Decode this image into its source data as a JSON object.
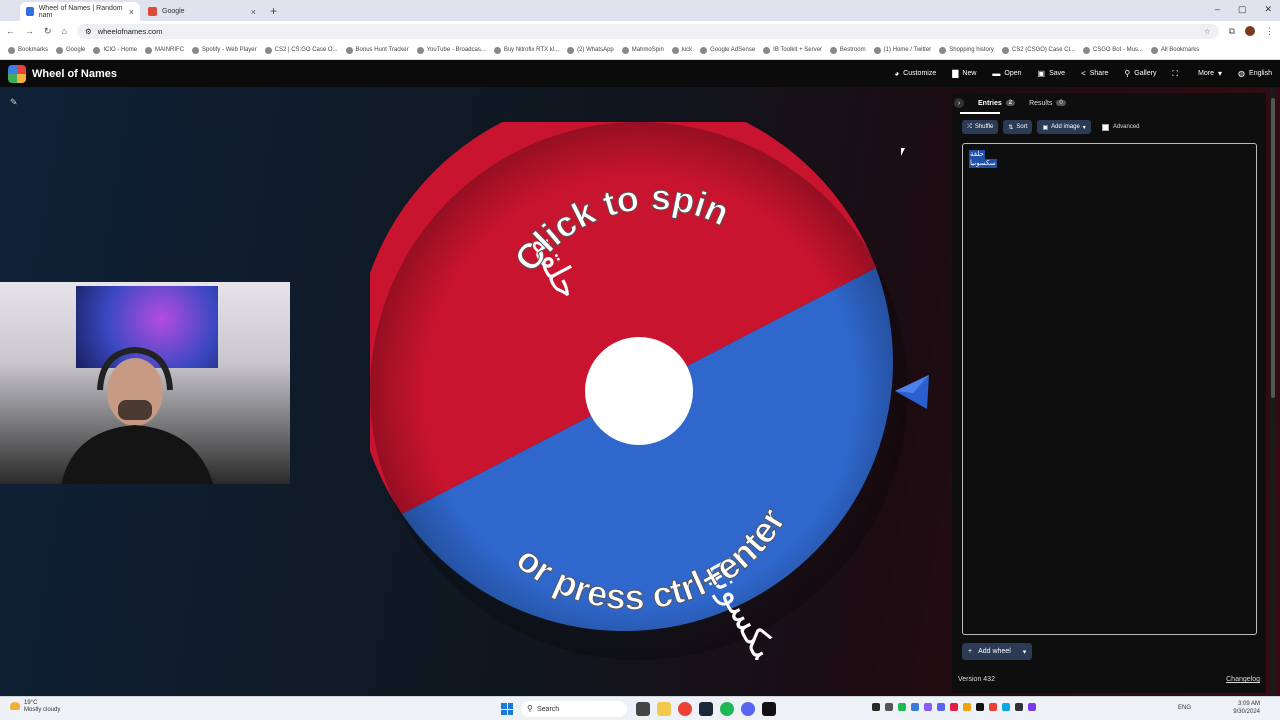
{
  "browser": {
    "tabs": [
      {
        "title": "Wheel of Names | Random nam",
        "active": true,
        "favicon_color": "#2f6fe0"
      },
      {
        "title": "Google",
        "active": false,
        "favicon_color": "#dd4b39"
      }
    ],
    "url": "wheelofnames.com",
    "bookmarks": [
      "Bookmarks",
      "Google",
      "ICIO - Home",
      "MAINRIFC",
      "Spotify - Web Player",
      "CS2 | CS:GO Case O...",
      "Bonus Hunt Tracker",
      "YouTube - Broadcas...",
      "Buy Nitrofix RTX kl...",
      "(2) WhatsApp",
      "MahmoSpin",
      "kick",
      "Google AdSense",
      "IB Toolkit + Server",
      "Bestroom",
      "(1) Home / Twitter",
      "Shopping history",
      "CS2 (CSGO) Case Cl...",
      "CSGO Bot - Mus...",
      "All Bookmarks"
    ]
  },
  "app": {
    "title": "Wheel of Names",
    "menu": [
      {
        "label": "Customize",
        "icon": "palette-icon",
        "glyph": "◕"
      },
      {
        "label": "New",
        "icon": "new-file-icon",
        "glyph": "▇"
      },
      {
        "label": "Open",
        "icon": "folder-icon",
        "glyph": "▬"
      },
      {
        "label": "Save",
        "icon": "save-icon",
        "glyph": "▣"
      },
      {
        "label": "Share",
        "icon": "share-icon",
        "glyph": "<"
      },
      {
        "label": "Gallery",
        "icon": "search-icon",
        "glyph": "⚲"
      },
      {
        "label": "",
        "icon": "fullscreen-icon",
        "glyph": "⛶"
      },
      {
        "label": "More",
        "icon": "chevron-down-icon",
        "glyph": "▾"
      },
      {
        "label": "English",
        "icon": "globe-icon",
        "glyph": "◍"
      }
    ]
  },
  "wheel": {
    "line1": "Click to spin",
    "line2": "or press ctrl+enter",
    "segments": [
      {
        "label": "حلقة",
        "color": "#c8142e"
      },
      {
        "label": "سكسونيا",
        "color": "#2f67cc"
      }
    ]
  },
  "panel": {
    "entries_label": "Entries",
    "entries_count": "2",
    "results_label": "Results",
    "results_count": "0",
    "shuffle": "Shuffle",
    "sort": "Sort",
    "add_image": "Add image",
    "advanced": "Advanced",
    "entries": [
      "حلقة",
      "سكسونيا"
    ],
    "add_wheel": "Add wheel",
    "version": "Version 432",
    "changelog": "Changelog"
  },
  "taskbar": {
    "temp": "19°C",
    "weather": "Mostly cloudy",
    "search": "Search",
    "lang": "ENG",
    "time": "3:09 AM",
    "date": "9/30/2024"
  }
}
